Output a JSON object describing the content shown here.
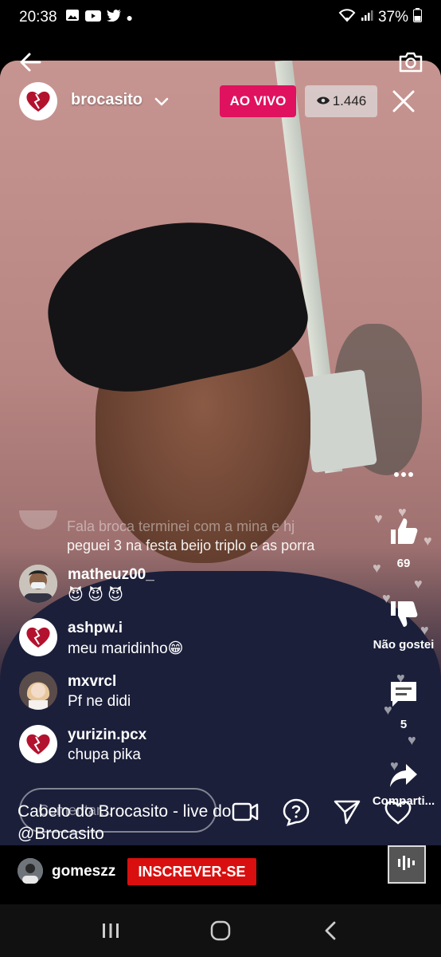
{
  "status_bar": {
    "time": "20:38",
    "battery": "37%",
    "icons": [
      "gallery-icon",
      "youtube-icon",
      "twitter-icon",
      "dot-icon",
      "wifi-icon",
      "signal-icon",
      "battery-icon"
    ]
  },
  "header": {
    "channel_name": "brocasito",
    "live_label": "AO VIVO",
    "viewer_count": "1.446"
  },
  "chat": {
    "faded_message": {
      "line1": "Fala broca terminei com a mina e hj",
      "line2": "peguei 3 na festa beijo triplo e as porra"
    },
    "messages": [
      {
        "user": "matheuz00_",
        "text": "😈 😈 😈"
      },
      {
        "user": "ashpw.i",
        "text": "meu maridinho😁"
      },
      {
        "user": "mxvrcl",
        "text": "Pf ne didi"
      },
      {
        "user": "yurizin.pcx",
        "text": "chupa pika"
      }
    ]
  },
  "side_actions": {
    "like_count": "69",
    "dislike_label": "Não gostei",
    "comment_count": "5",
    "share_label": "Comparti..."
  },
  "bottom": {
    "caption_line1": "Cabelo do Brocasito - live do",
    "caption_line2": "@Brocasito",
    "comment_placeholder": "Comentar..."
  },
  "subscription": {
    "user": "gomeszz",
    "subscribe_label": "INSCREVER-SE"
  },
  "colors": {
    "live_badge": "#e0115f",
    "subscribe": "#d90f0f"
  }
}
